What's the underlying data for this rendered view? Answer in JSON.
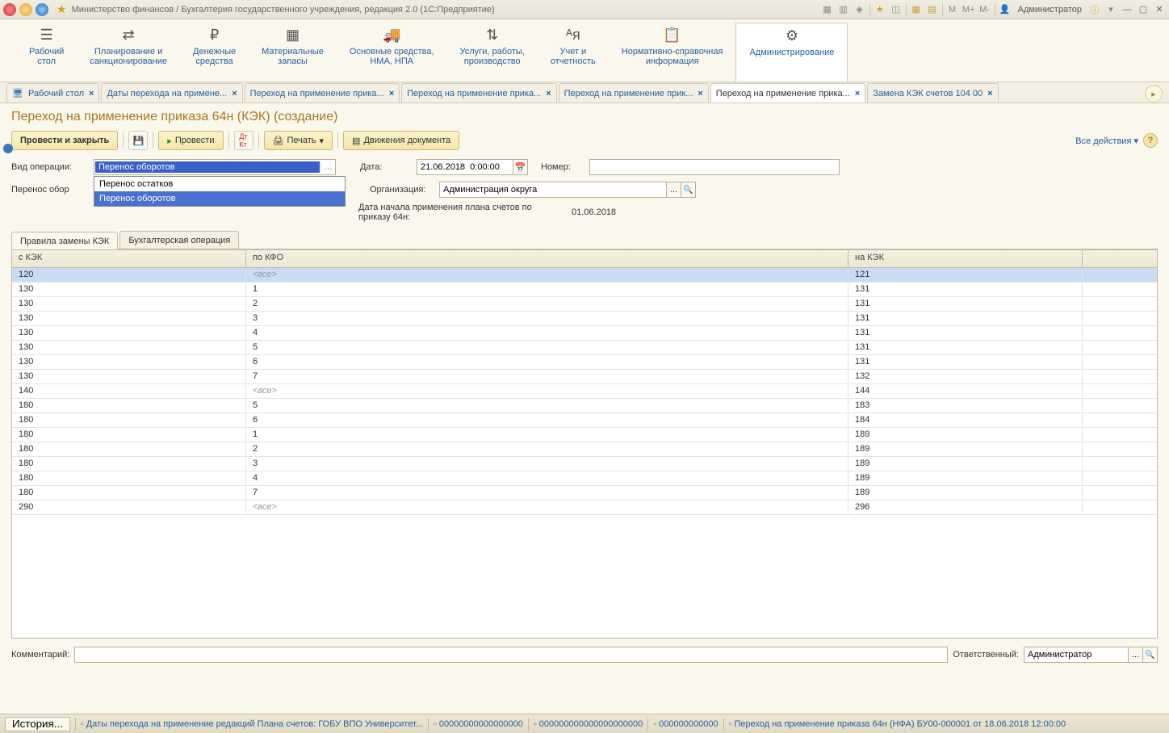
{
  "titlebar": {
    "title": "Министерство финансов / Бухгалтерия государственного учреждения, редакция 2.0  (1С:Предприятие)",
    "user": "Администратор",
    "markers": {
      "m": "M",
      "mplus": "M+",
      "mminus": "M-"
    }
  },
  "sections": [
    {
      "label": "Рабочий\nстол"
    },
    {
      "label": "Планирование и\nсанкционирование"
    },
    {
      "label": "Денежные\nсредства"
    },
    {
      "label": "Материальные\nзапасы"
    },
    {
      "label": "Основные средства,\nНМА, НПА"
    },
    {
      "label": "Услуги, работы,\nпроизводство"
    },
    {
      "label": "Учет и\nотчетность"
    },
    {
      "label": "Нормативно-справочная\nинформация"
    },
    {
      "label": "Администрирование"
    }
  ],
  "doc_tabs": [
    {
      "label": "Рабочий стол",
      "desktop": true
    },
    {
      "label": "Даты перехода на примене..."
    },
    {
      "label": "Переход на применение прика..."
    },
    {
      "label": "Переход на применение прика..."
    },
    {
      "label": "Переход на применение прик..."
    },
    {
      "label": "Переход на применение прика...",
      "active": true
    },
    {
      "label": "Замена КЭК счетов 104 00"
    }
  ],
  "page_title": "Переход на применение приказа 64н (КЭК) (создание)",
  "cmd": {
    "post_close": "Провести и закрыть",
    "post": "Провести",
    "print": "Печать",
    "movements": "Движения документа",
    "all_actions": "Все действия"
  },
  "form": {
    "op_type_label": "Вид операции:",
    "op_type_value": "Перенос оборотов",
    "dropdown": [
      "Перенос остатков",
      "Перенос оборотов"
    ],
    "transfer_label": "Перенос обор",
    "date_label": "Дата:",
    "date_value": "21.06.2018  0:00:00",
    "number_label": "Номер:",
    "org_label": "Организация:",
    "org_value": "Администрация округа",
    "plan_date_label": "Дата начала применения плана счетов по приказу 64н:",
    "plan_date_value": "01.06.2018"
  },
  "subtabs": [
    "Правила замены КЭК",
    "Бухгалтерская операция"
  ],
  "grid": {
    "headers": [
      "с КЭК",
      "по КФО",
      "на КЭК"
    ],
    "rows": [
      {
        "c1": "120",
        "c2": "<все>",
        "c3": "121",
        "sel": true,
        "muted": true
      },
      {
        "c1": "130",
        "c2": "1",
        "c3": "131"
      },
      {
        "c1": "130",
        "c2": "2",
        "c3": "131"
      },
      {
        "c1": "130",
        "c2": "3",
        "c3": "131"
      },
      {
        "c1": "130",
        "c2": "4",
        "c3": "131"
      },
      {
        "c1": "130",
        "c2": "5",
        "c3": "131"
      },
      {
        "c1": "130",
        "c2": "6",
        "c3": "131"
      },
      {
        "c1": "130",
        "c2": "7",
        "c3": "132"
      },
      {
        "c1": "140",
        "c2": "<все>",
        "c3": "144",
        "muted": true
      },
      {
        "c1": "180",
        "c2": "5",
        "c3": "183"
      },
      {
        "c1": "180",
        "c2": "6",
        "c3": "184"
      },
      {
        "c1": "180",
        "c2": "1",
        "c3": "189"
      },
      {
        "c1": "180",
        "c2": "2",
        "c3": "189"
      },
      {
        "c1": "180",
        "c2": "3",
        "c3": "189"
      },
      {
        "c1": "180",
        "c2": "4",
        "c3": "189"
      },
      {
        "c1": "180",
        "c2": "7",
        "c3": "189"
      },
      {
        "c1": "290",
        "c2": "<все>",
        "c3": "296",
        "muted": true
      }
    ]
  },
  "footer": {
    "comment_label": "Комментарий:",
    "resp_label": "Ответственный:",
    "resp_value": "Администратор"
  },
  "statusbar": {
    "history": "История...",
    "items": [
      "Даты перехода на применение редакций Плана счетов: ГОБУ ВПО Университет...",
      "00000000000000000",
      "000000000000000000000",
      "000000000000",
      "Переход на применение приказа 64н (НФА) БУ00-000001 от 18.06.2018 12:00:00"
    ]
  }
}
